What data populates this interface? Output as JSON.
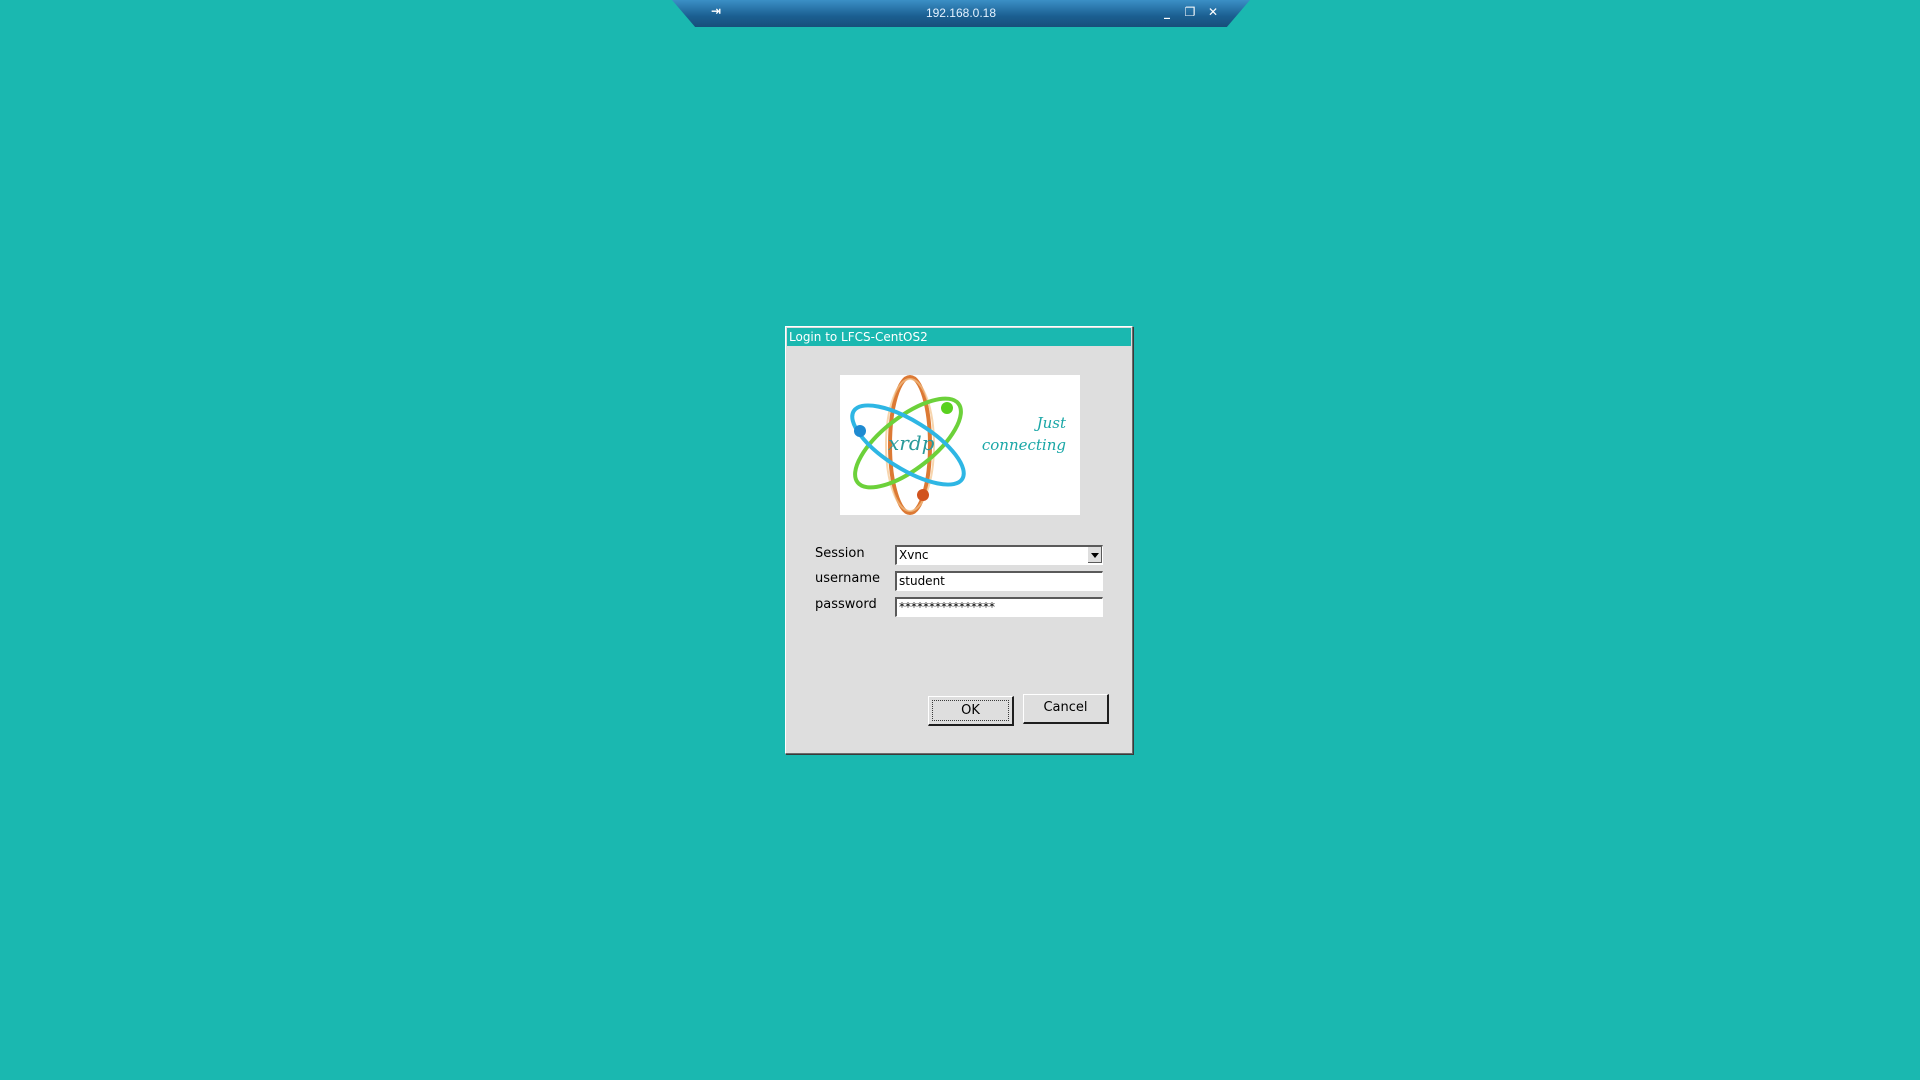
{
  "connection_bar": {
    "host": "192.168.0.18",
    "pin_icon": "pin-icon",
    "minimize_icon": "minimize-icon",
    "restore_icon": "restore-icon",
    "close_icon": "close-icon",
    "minimize_glyph": "_",
    "restore_glyph": "❐",
    "close_glyph": "✕",
    "pin_glyph": "⇥"
  },
  "login_dialog": {
    "title": "Login to LFCS-CentOS2",
    "logo": {
      "wordmark": "xrdp",
      "tagline_line1": "Just",
      "tagline_line2": "connecting"
    },
    "session_label": "Session",
    "session_value": "Xvnc",
    "username_label": "username",
    "username_value": "student",
    "password_label": "password",
    "password_value": "****************",
    "ok_label": "OK",
    "cancel_label": "Cancel"
  },
  "colors": {
    "desktop_background": "#1ab8b0",
    "dialog_face": "#dedede",
    "title_bar": "#1ab8b0"
  }
}
